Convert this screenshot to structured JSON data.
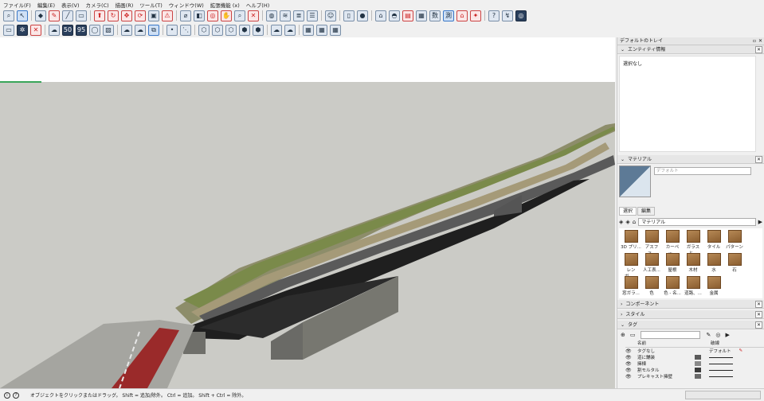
{
  "menu": [
    "ファイル(F)",
    "編集(E)",
    "表示(V)",
    "カメラ(C)",
    "描画(R)",
    "ツール(T)",
    "ウィンドウ(W)",
    "拡張機能 (x)",
    "ヘルプ(H)"
  ],
  "toolbar1": [
    "search-icon",
    "select-icon",
    "eraser-icon",
    "pencil-icon",
    "line-icon",
    "rectangle-icon",
    "move-icon",
    "rotate-icon",
    "scale-icon",
    "push-pull-icon",
    "offset-icon",
    "warning-icon",
    "tape-icon",
    "paint-icon",
    "orbit-icon",
    "pan-icon",
    "zoom-icon",
    "zoom-extents-icon",
    "globe-icon",
    "layers-icon",
    "section-icon",
    "user-icon",
    "person-icon",
    "bridge-icon",
    "dimension-icon",
    "save-icon",
    "badge-icon"
  ],
  "toolbar1_labels": {
    "kanji1": "数",
    "kanji2": "測"
  },
  "toolbar2": [
    "folder-icon",
    "gear-icon",
    "close-circle-icon",
    "cloud-download-icon",
    "50-icon",
    "95-icon",
    "refresh-icon",
    "stripes-icon",
    "cloud-icon",
    "cloud-up-icon",
    "cloud-select-icon",
    "dot-icon",
    "dotted-line-icon",
    "hexagon-icon",
    "cube-icon",
    "cloud2-icon",
    "grid-icon"
  ],
  "status": {
    "message": "オブジェクトをクリックまたはドラッグ。 Shift = 追加/除外。 Ctrl = 追加。 Shift + Ctrl = 除外。"
  },
  "tray": {
    "title": "デフォルトのトレイ",
    "entity": {
      "header": "エンティティ情報",
      "value": "選択なし"
    },
    "material": {
      "header": "マテリアル",
      "name_placeholder": "デフォルト",
      "tabs": [
        "選択",
        "編集"
      ],
      "dropdown": "マテリアル",
      "items": [
        "3D プリ...",
        "アスファ...",
        "カーペッ...",
        "ガラスと...",
        "タイル",
        "パターン",
        "レンガ、...",
        "人工表...",
        "屋根",
        "木材",
        "水",
        "石",
        "窓ガラ...",
        "色",
        "色 - 名...",
        "道路、...",
        "金属"
      ]
    },
    "components": {
      "header": "コンポーネント"
    },
    "styles": {
      "header": "スタイル"
    },
    "tags": {
      "header": "タグ",
      "search_placeholder": "",
      "columns": {
        "name": "名前",
        "dash": "破線"
      },
      "rows": [
        {
          "name": "タグなし",
          "dash": "デフォルト",
          "color": "",
          "hasLine": false
        },
        {
          "name": "道に舗装",
          "dash": "",
          "color": "#5a5a5a",
          "hasLine": true
        },
        {
          "name": "擁棟",
          "dash": "",
          "color": "#8a8a8a",
          "hasLine": true
        },
        {
          "name": "割モルタル",
          "dash": "",
          "color": "#3c3c3c",
          "hasLine": true
        },
        {
          "name": "プレキャスト擁壁",
          "dash": "",
          "color": "#6a6a6a",
          "hasLine": true
        }
      ]
    }
  }
}
